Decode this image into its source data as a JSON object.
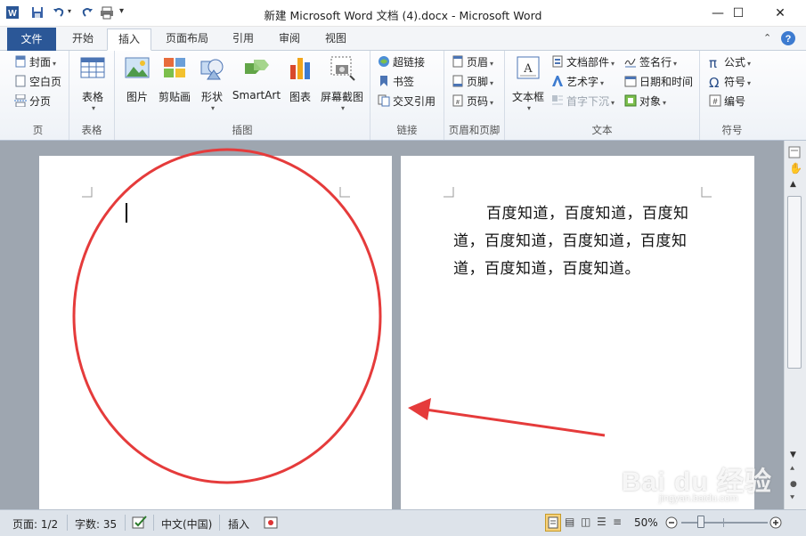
{
  "window": {
    "title": "新建 Microsoft Word 文档 (4).docx  -  Microsoft Word",
    "minimize": "—",
    "maximize": "☐",
    "close": "✕"
  },
  "tabs": {
    "file": "文件",
    "items": [
      "开始",
      "插入",
      "页面布局",
      "引用",
      "审阅",
      "视图"
    ],
    "active": "插入"
  },
  "ribbon": {
    "pages_group": {
      "label": "页",
      "cover": "封面",
      "blank": "空白页",
      "break": "分页"
    },
    "table_group": {
      "label": "表格",
      "table": "表格"
    },
    "illus_group": {
      "label": "插图",
      "picture": "图片",
      "clipart": "剪贴画",
      "shapes": "形状",
      "smartart": "SmartArt",
      "chart": "图表",
      "screenshot": "屏幕截图"
    },
    "links_group": {
      "label": "链接",
      "hyperlink": "超链接",
      "bookmark": "书签",
      "crossref": "交叉引用"
    },
    "hf_group": {
      "label": "页眉和页脚",
      "header": "页眉",
      "footer": "页脚",
      "pagenum": "页码"
    },
    "text_group": {
      "label": "文本",
      "textbox": "文本框",
      "quickparts": "文档部件",
      "wordart": "艺术字",
      "dropcap": "首字下沉",
      "sigline": "签名行",
      "datetime": "日期和时间",
      "object": "对象"
    },
    "symbol_group": {
      "label": "符号",
      "equation": "公式",
      "symbol": "符号",
      "number": "编号"
    }
  },
  "document": {
    "paragraph": "百度知道，百度知道，百度知道，百度知道，百度知道，百度知道，百度知道，百度知道。"
  },
  "status": {
    "page": "页面: 1/2",
    "words": "字数: 35",
    "language": "中文(中国)",
    "mode": "插入",
    "zoom": "50%"
  },
  "watermark": {
    "text": "Bai du 经验",
    "subtext": "jingyan.baidu.com"
  },
  "colors": {
    "file_tab": "#2b5797",
    "annotation_red": "#e53b3b",
    "doc_background": "#9ea6b0"
  }
}
